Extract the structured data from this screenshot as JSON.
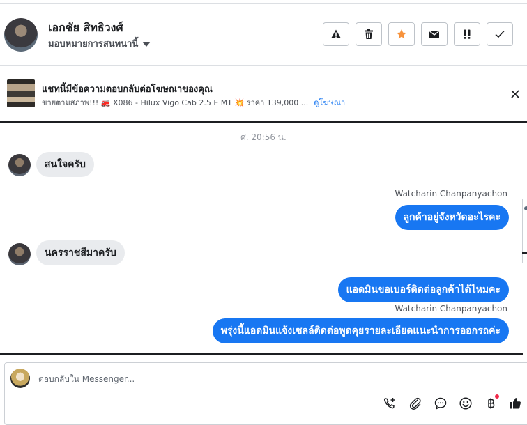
{
  "header": {
    "contact_name": "เอกชัย สิทธิวงศ์",
    "assign_label": "มอบหมายการสนทนานี้",
    "actions": [
      {
        "icon": "warning-icon"
      },
      {
        "icon": "trash-icon"
      },
      {
        "icon": "star-icon",
        "color": "#f7923b"
      },
      {
        "icon": "envelope-icon"
      },
      {
        "icon": "double-exclamation-icon"
      },
      {
        "icon": "checkmark-icon"
      }
    ]
  },
  "ad_banner": {
    "title": "แชทนี้มีข้อความตอบกลับต่อโฆษณาของคุณ",
    "subtitle": "ขายตามสภาพ!!! 🚒 X086 - Hilux Vigo Cab 2.5 E MT 💥 ราคา 139,000 ...",
    "link_label": "ดูโฆษณา"
  },
  "conversation": {
    "timestamp": "ศ. 20:56 น.",
    "messages": [
      {
        "direction": "in",
        "text": "สนใจครับ"
      },
      {
        "direction": "out",
        "sender": "Watcharin Chanpanyachon",
        "text": "ลูกค้าอยู่จังหวัดอะไรคะ"
      },
      {
        "direction": "in",
        "text": "นครราชสีมาครับ"
      },
      {
        "direction": "out",
        "text": "แอดมินขอเบอร์ติดต่อลูกค้าได้ไหมคะ"
      },
      {
        "direction": "out",
        "sender": "Watcharin Chanpanyachon",
        "text": "พรุ่งนี้แอดมินแจ้งเซลล์ติดต่อพูดคุยรายละเอียดแนะนำการออกรถค่ะ"
      }
    ]
  },
  "composer": {
    "placeholder": "ตอบกลับใน Messenger...",
    "tools": [
      "call-plus-icon",
      "paperclip-icon",
      "chat-bubble-icon",
      "smiley-icon",
      "baht-icon",
      "thumbs-up-icon"
    ]
  },
  "colors": {
    "accent": "#1877f2",
    "incoming_bubble": "#e9ebee",
    "star": "#f7923b",
    "notification_dot": "#f02849"
  }
}
